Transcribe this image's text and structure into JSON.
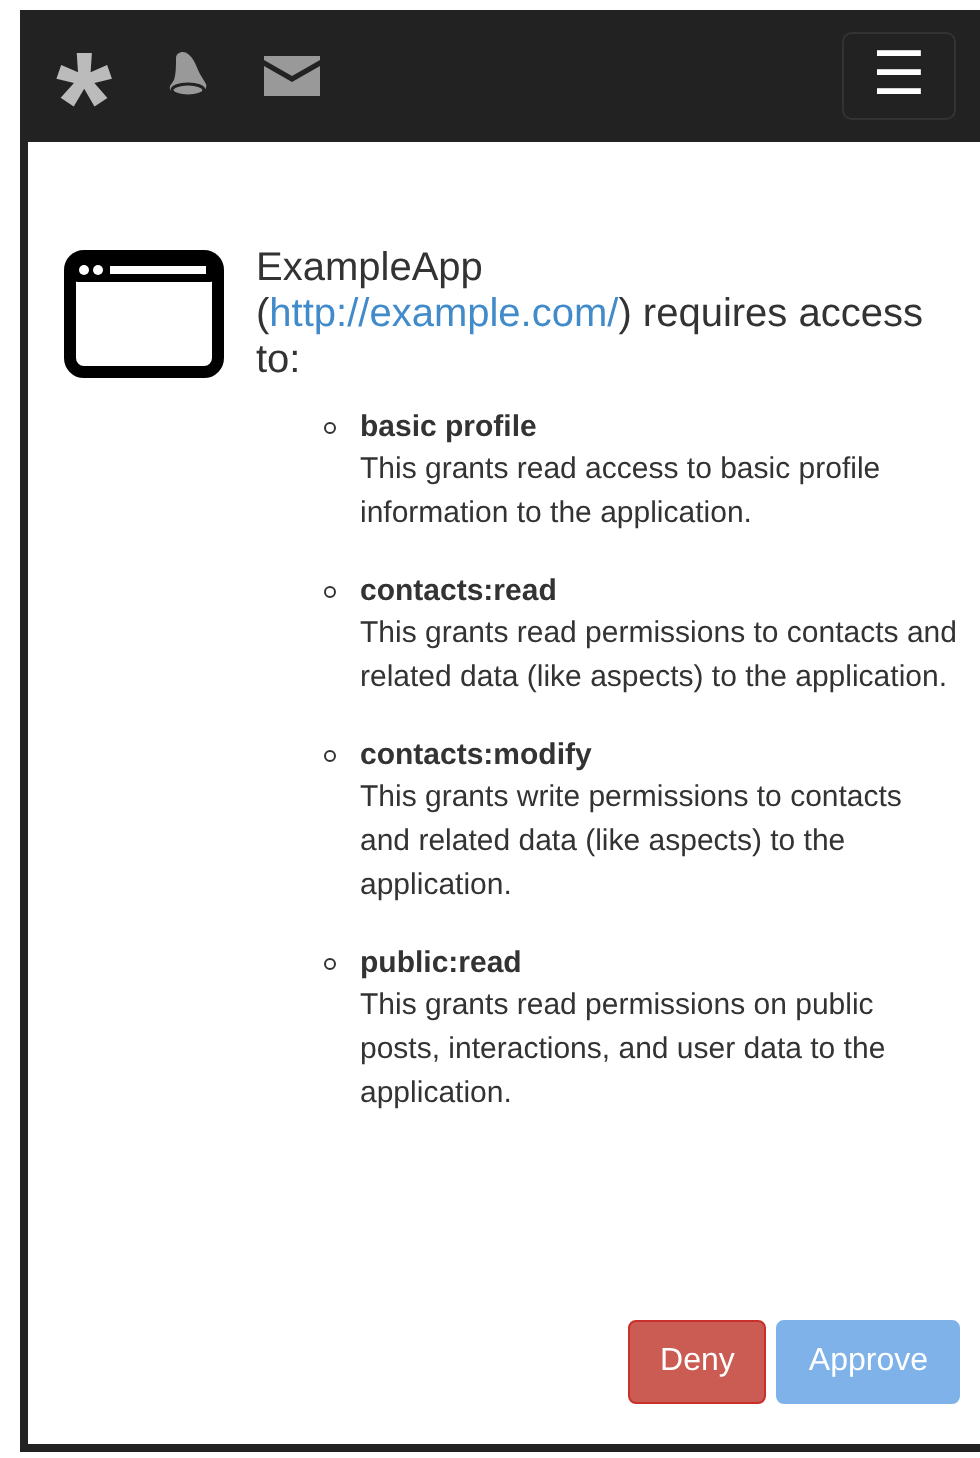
{
  "navbar": {
    "logo": "*",
    "menu_label": "☰"
  },
  "request": {
    "app_name": "ExampleApp",
    "app_url": "http://example.com/",
    "prefix": "(",
    "suffix": ") requires access to:"
  },
  "scopes": [
    {
      "name": "basic profile",
      "description": "This grants read access to basic profile information to the application."
    },
    {
      "name": "contacts:read",
      "description": "This grants read permissions to contacts and related data (like aspects) to the application."
    },
    {
      "name": "contacts:modify",
      "description": "This grants write permissions to contacts and related data (like aspects) to the application."
    },
    {
      "name": "public:read",
      "description": "This grants read permissions on public posts, interactions, and user data to the application."
    }
  ],
  "buttons": [
    {
      "label": "Deny",
      "kind": "danger",
      "disabled": false
    },
    {
      "label": "Approve",
      "kind": "primary",
      "disabled": true
    }
  ]
}
